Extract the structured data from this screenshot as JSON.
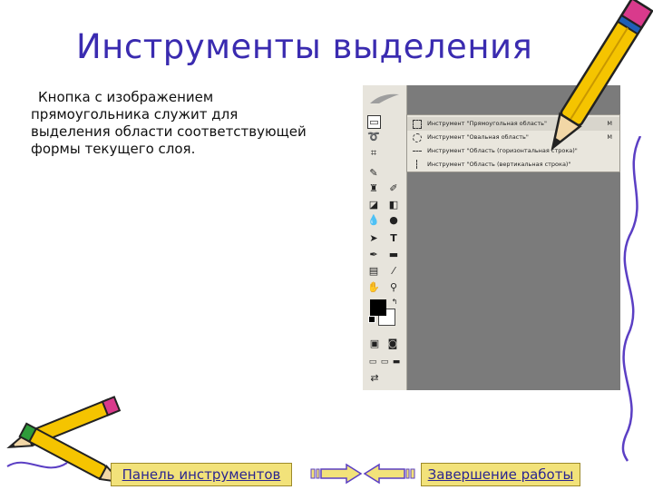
{
  "slide": {
    "title": "Инструменты выделения",
    "body_lines": [
      "Кнопка с изображением",
      "прямоугольника служит для",
      "выделения области соответствующей",
      "формы текущего слоя."
    ]
  },
  "toolbox": {
    "flyout_items": [
      {
        "label": "Инструмент \"Прямоугольная область\"",
        "shortcut": "M",
        "icon": "rect-marquee-icon"
      },
      {
        "label": "Инструмент \"Овальная область\"",
        "shortcut": "M",
        "icon": "ellipse-marquee-icon"
      },
      {
        "label": "Инструмент \"Область (горизонтальная строка)\"",
        "shortcut": "",
        "icon": "row-marquee-icon"
      },
      {
        "label": "Инструмент \"Область (вертикальная строка)\"",
        "shortcut": "",
        "icon": "column-marquee-icon"
      }
    ],
    "type_tool_glyph": "T"
  },
  "nav": {
    "tools_button": "Панель инструментов",
    "finish_button": "Завершение работы"
  },
  "colors": {
    "title": "#3a2bb0",
    "button_fill": "#f2e27a",
    "panel_gray": "#7b7b7b",
    "pencil_yellow": "#f5c400"
  }
}
